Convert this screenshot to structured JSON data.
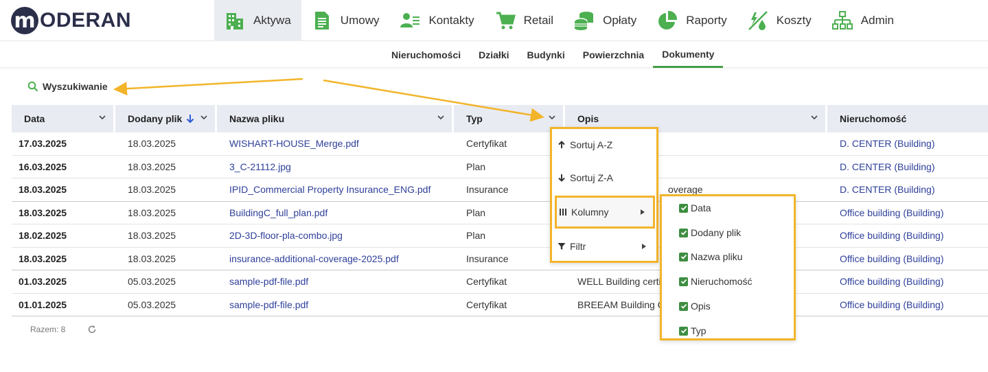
{
  "brand": {
    "logo_letter": "m",
    "logo_text": "ODERAN"
  },
  "nav": [
    {
      "label": "Aktywa",
      "icon": "buildings-icon"
    },
    {
      "label": "Umowy",
      "icon": "document-icon"
    },
    {
      "label": "Kontakty",
      "icon": "contacts-icon"
    },
    {
      "label": "Retail",
      "icon": "cart-icon"
    },
    {
      "label": "Opłaty",
      "icon": "coins-icon"
    },
    {
      "label": "Raporty",
      "icon": "pie-chart-icon"
    },
    {
      "label": "Koszty",
      "icon": "utility-icon"
    },
    {
      "label": "Admin",
      "icon": "org-chart-icon"
    }
  ],
  "subnav": [
    "Nieruchomości",
    "Działki",
    "Budynki",
    "Powierzchnia",
    "Dokumenty"
  ],
  "search_label": "Wyszukiwanie",
  "columns": [
    "Data",
    "Dodany plik",
    "Nazwa pliku",
    "Typ",
    "Opis",
    "Nieruchomość"
  ],
  "rows": [
    [
      "17.03.2025",
      "18.03.2025",
      "WISHART-HOUSE_Merge.pdf",
      "Certyfikat",
      "",
      "D. CENTER (Building)"
    ],
    [
      "16.03.2025",
      "18.03.2025",
      "3_C-21112.jpg",
      "Plan",
      "",
      "D. CENTER (Building)"
    ],
    [
      "18.03.2025",
      "18.03.2025",
      "IPID_Commercial Property Insurance_ENG.pdf",
      "Insurance",
      "overage",
      "D. CENTER (Building)"
    ],
    [
      "18.03.2025",
      "18.03.2025",
      "BuildingC_full_plan.pdf",
      "Plan",
      "",
      "Office building (Building)"
    ],
    [
      "18.02.2025",
      "18.03.2025",
      "2D-3D-floor-pla-combo.jpg",
      "Plan",
      "",
      "Office building (Building)"
    ],
    [
      "18.03.2025",
      "18.03.2025",
      "insurance-additional-coverage-2025.pdf",
      "Insurance",
      "",
      "Office building (Building)"
    ],
    [
      "01.03.2025",
      "05.03.2025",
      "sample-pdf-file.pdf",
      "Certyfikat",
      "WELL Building certifi",
      "Office building (Building)"
    ],
    [
      "01.01.2025",
      "05.03.2025",
      "sample-pdf-file.pdf",
      "Certyfikat",
      "BREEAM Building Ce",
      "Office building (Building)"
    ]
  ],
  "footer": {
    "total_label": "Razem: 8"
  },
  "menu": {
    "sort_asc": "Sortuj A-Z",
    "sort_desc": "Sortuj Z-A",
    "columns": "Kolumny",
    "filter": "Filtr"
  },
  "column_toggles": [
    "Data",
    "Dodany plik",
    "Nazwa pliku",
    "Nieruchomość",
    "Opis",
    "Typ"
  ],
  "colors": {
    "accent_green": "#43a047",
    "link_blue": "#2e3f9a",
    "highlight_orange": "#f2b429",
    "header_bg": "#e9ebf3"
  }
}
